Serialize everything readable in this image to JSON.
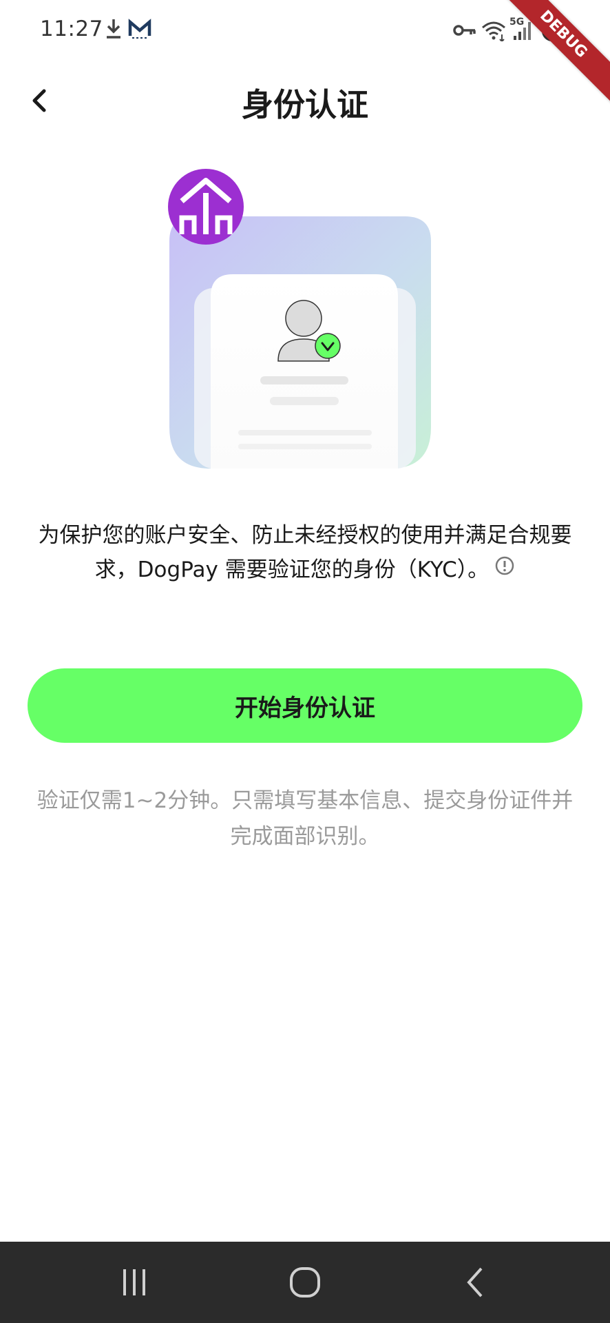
{
  "status_bar": {
    "time": "11:27",
    "debug_label": "DEBUG",
    "network_label": "5G"
  },
  "header": {
    "title": "身份认证",
    "back_icon": "chevron-left-icon"
  },
  "main": {
    "description": "为保护您的账户安全、防止未经授权的使用并满足合规要求，DogPay 需要验证您的身份（KYC）。",
    "start_button_label": "开始身份认证",
    "hint": "验证仅需1~2分钟。只需填写基本信息、提交身份证件并完成面部识别。"
  },
  "colors": {
    "accent": "#66ff66",
    "badge": "#9c2fd1",
    "nav_bar": "#2b2b2b"
  }
}
